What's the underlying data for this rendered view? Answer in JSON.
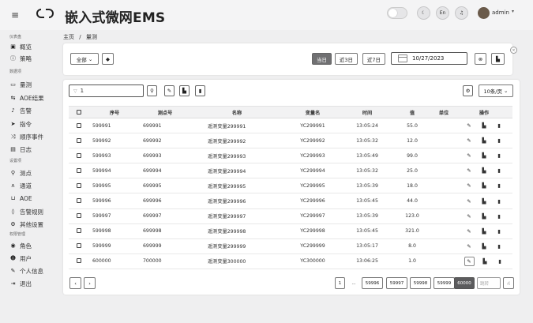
{
  "header": {
    "title": "嵌入式微网EMS",
    "lang_label": "En",
    "user_name": "admin"
  },
  "sidebar": {
    "groups": [
      {
        "title": "仪表盘",
        "items": [
          {
            "label": "概览",
            "icon": "chart-icon"
          },
          {
            "label": "策略",
            "icon": "info-icon"
          }
        ]
      },
      {
        "title": "数据项",
        "items": [
          {
            "label": "量测",
            "icon": "monitor-icon"
          },
          {
            "label": "AOE结果",
            "icon": "arrows-icon"
          },
          {
            "label": "告警",
            "icon": "bell-icon"
          },
          {
            "label": "指令",
            "icon": "send-icon"
          },
          {
            "label": "顺序事件",
            "icon": "shuffle-icon"
          },
          {
            "label": "日志",
            "icon": "log-icon"
          }
        ]
      },
      {
        "title": "设置项",
        "items": [
          {
            "label": "测点",
            "icon": "pin-icon"
          },
          {
            "label": "通道",
            "icon": "channel-icon"
          },
          {
            "label": "AOE",
            "icon": "flow-icon"
          },
          {
            "label": "告警规则",
            "icon": "shield-icon"
          },
          {
            "label": "其他设置",
            "icon": "gear-icon"
          }
        ]
      },
      {
        "title": "权限管理",
        "items": [
          {
            "label": "角色",
            "icon": "role-icon"
          },
          {
            "label": "用户",
            "icon": "users-icon"
          },
          {
            "label": "个人信息",
            "icon": "edit-icon"
          },
          {
            "label": "退出",
            "icon": "logout-icon"
          }
        ]
      }
    ]
  },
  "breadcrumb": {
    "home": "主页",
    "separator": "/",
    "current": "量测"
  },
  "filters": {
    "scope_select": "全部",
    "ranges": [
      "当日",
      "近3日",
      "近7日"
    ],
    "active_range": "当日",
    "date": "10/27/2023"
  },
  "table_toolbar": {
    "search_value": "1",
    "page_size": "10条/页"
  },
  "table": {
    "columns": [
      "序号",
      "测点号",
      "名称",
      "变量名",
      "时间",
      "值",
      "单位",
      "操作"
    ],
    "rows": [
      [
        "599991",
        "699991",
        "遥测变量299991",
        "YC299991",
        "13:05:24",
        "55.0",
        ""
      ],
      [
        "599992",
        "699992",
        "遥测变量299992",
        "YC299992",
        "13:05:32",
        "12.0",
        ""
      ],
      [
        "599993",
        "699993",
        "遥测变量299993",
        "YC299993",
        "13:05:49",
        "99.0",
        ""
      ],
      [
        "599994",
        "699994",
        "遥测变量299994",
        "YC299994",
        "13:05:32",
        "25.0",
        ""
      ],
      [
        "599995",
        "699995",
        "遥测变量299995",
        "YC299995",
        "13:05:39",
        "18.0",
        ""
      ],
      [
        "599996",
        "699996",
        "遥测变量299996",
        "YC299996",
        "13:05:45",
        "44.0",
        ""
      ],
      [
        "599997",
        "699997",
        "遥测变量299997",
        "YC299997",
        "13:05:39",
        "123.0",
        ""
      ],
      [
        "599998",
        "699998",
        "遥测变量299998",
        "YC299998",
        "13:05:45",
        "321.0",
        ""
      ],
      [
        "599999",
        "699999",
        "遥测变量299999",
        "YC299999",
        "13:05:17",
        "8.0",
        ""
      ],
      [
        "600000",
        "700000",
        "遥测变量300000",
        "YC300000",
        "13:06:25",
        "1.0",
        ""
      ]
    ]
  },
  "pagination": {
    "first": "1",
    "ellipsis": "...",
    "pages": [
      "59996",
      "59997",
      "59998",
      "59999",
      "60000"
    ],
    "active": "60000",
    "goto_placeholder": "跳转"
  }
}
